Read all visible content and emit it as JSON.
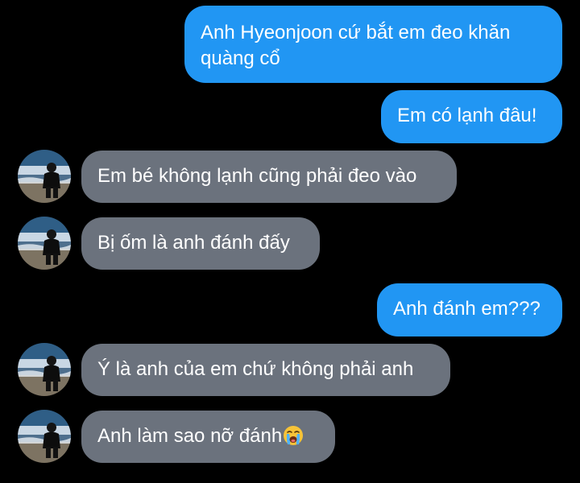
{
  "conversation": {
    "messages": [
      {
        "id": "m1",
        "direction": "outgoing",
        "text": "Anh Hyeonjoon cứ bắt em đeo khăn quàng cổ"
      },
      {
        "id": "m2",
        "direction": "outgoing",
        "text": "Em có lạnh đâu!"
      },
      {
        "id": "m3",
        "direction": "incoming",
        "text": "Em bé không lạnh cũng phải đeo vào"
      },
      {
        "id": "m4",
        "direction": "incoming",
        "text": "Bị ốm là anh đánh đấy"
      },
      {
        "id": "m5",
        "direction": "outgoing",
        "text": "Anh đánh em???"
      },
      {
        "id": "m6",
        "direction": "incoming",
        "text": "Ý là anh của em chứ không phải anh"
      },
      {
        "id": "m7",
        "direction": "incoming",
        "text": "Anh làm sao nỡ đánh",
        "emoji_icon": "loudly-crying-face-emoji"
      }
    ]
  },
  "colors": {
    "background": "#000000",
    "outgoing_bubble": "#2196f3",
    "incoming_bubble": "#6b727d",
    "text": "#ffffff"
  },
  "icons": {
    "avatar": "contact-avatar-photo",
    "emoji": "loudly-crying-face-emoji"
  }
}
